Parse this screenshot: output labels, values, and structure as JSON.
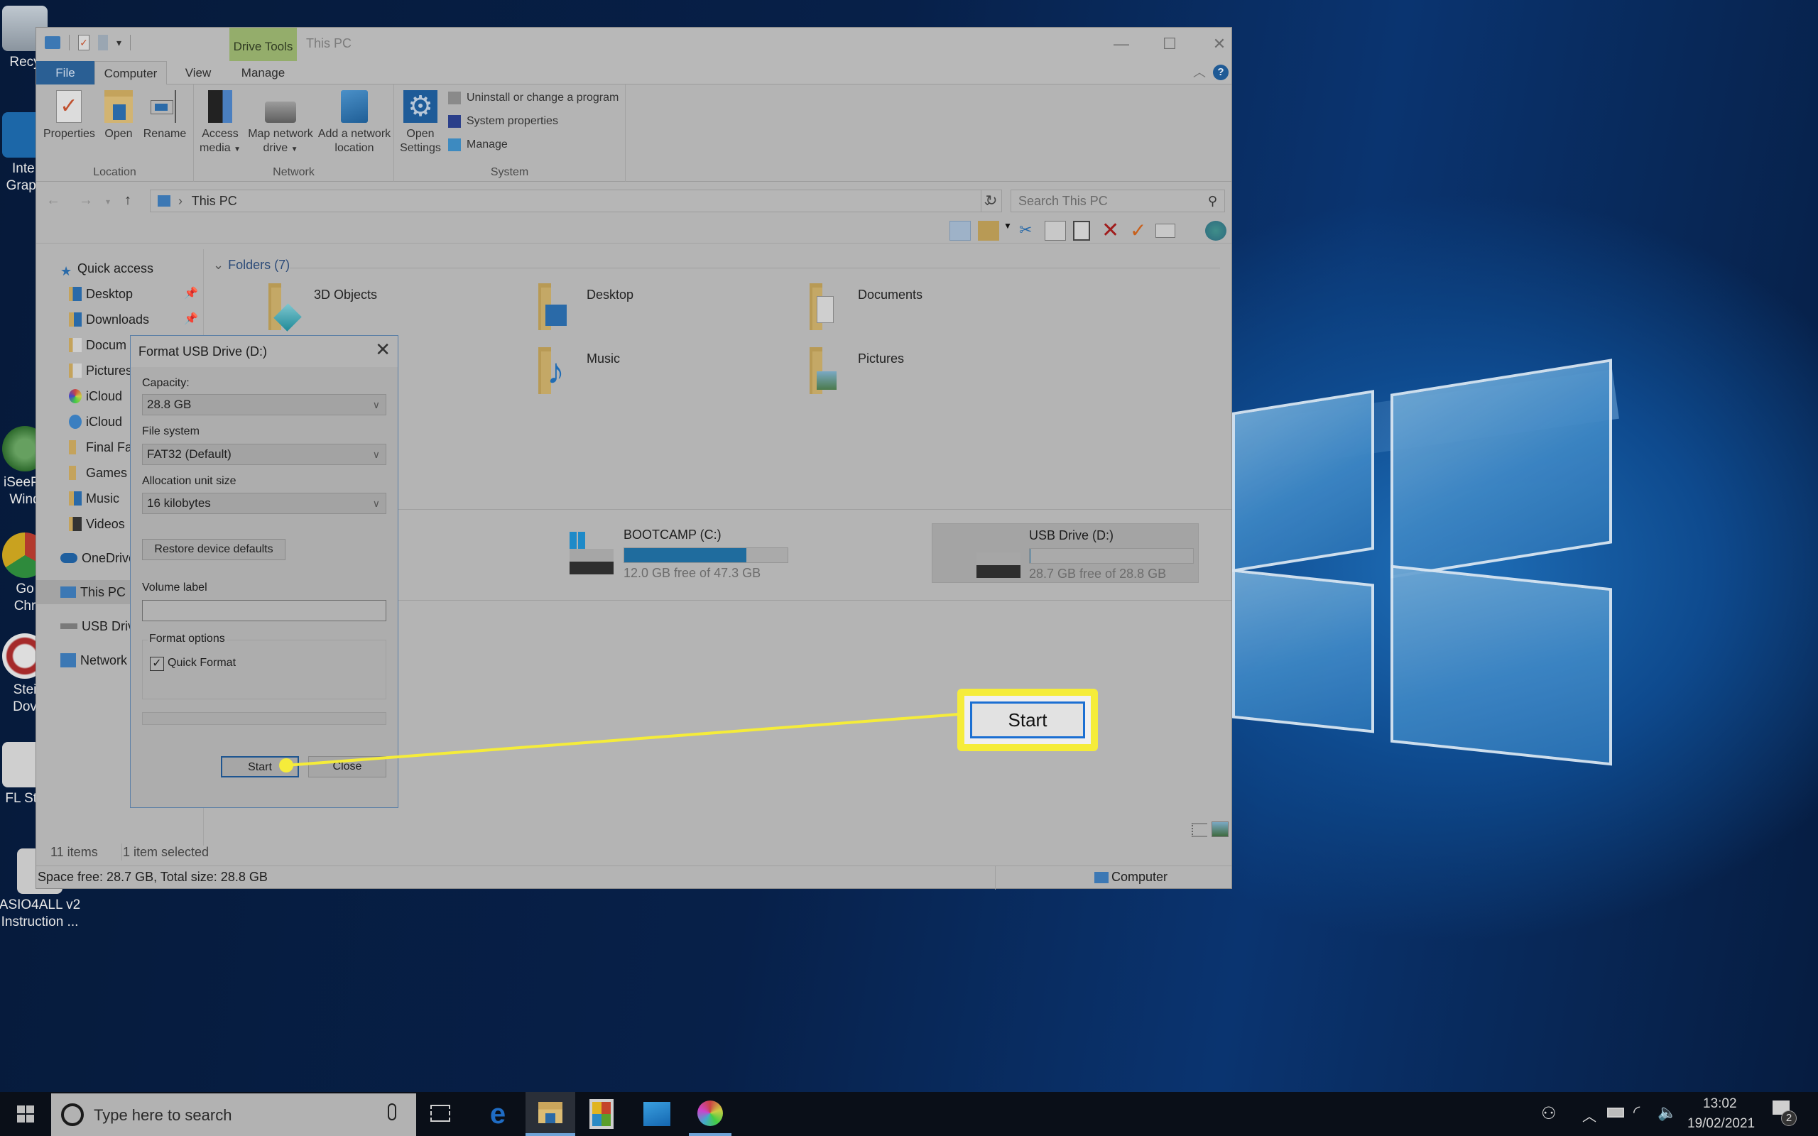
{
  "desktop": {
    "icons": [
      {
        "label": "Recy",
        "name": "recycle-bin"
      },
      {
        "label": "Intel Graph",
        "name": "intel-graphics"
      },
      {
        "label": "iSeePa Wind",
        "name": "iseepassword"
      },
      {
        "label": "Go Chr",
        "name": "google-chrome"
      },
      {
        "label": "Stei Dov",
        "name": "steinberg-download"
      },
      {
        "label": "FL Stu",
        "name": "fl-studio"
      },
      {
        "label": "ASIO4ALL v2 Instruction ...",
        "name": "asio4all"
      }
    ]
  },
  "explorer": {
    "title": "This PC",
    "context_tab": "Drive Tools",
    "tabs": [
      "File",
      "Computer",
      "View",
      "Manage"
    ],
    "active_tab": "Computer",
    "ribbon": {
      "groups": [
        {
          "label": "Location",
          "buttons": [
            "Properties",
            "Open",
            "Rename"
          ]
        },
        {
          "label": "Network",
          "buttons": [
            "Access media",
            "Map network drive",
            "Add a network location"
          ]
        },
        {
          "label": "System",
          "buttons": [
            "Open Settings"
          ],
          "small_buttons": [
            "Uninstall or change a program",
            "System properties",
            "Manage"
          ]
        }
      ],
      "btn_lines": {
        "properties": "Properties",
        "open": "Open",
        "rename": "Rename",
        "access1": "Access",
        "access2": "media",
        "map1": "Map network",
        "map2": "drive",
        "add1": "Add a network",
        "add2": "location",
        "settings1": "Open",
        "settings2": "Settings"
      }
    },
    "address": {
      "path": "This PC",
      "search_placeholder": "Search This PC"
    },
    "nav": {
      "items": [
        {
          "label": "Quick access",
          "level": 0
        },
        {
          "label": "Desktop",
          "level": 1,
          "pinned": true
        },
        {
          "label": "Downloads",
          "level": 1,
          "pinned": true
        },
        {
          "label": "Docum",
          "level": 1
        },
        {
          "label": "Pictures",
          "level": 1
        },
        {
          "label": "iCloud",
          "level": 1
        },
        {
          "label": "iCloud",
          "level": 1
        },
        {
          "label": "Final Fa",
          "level": 1
        },
        {
          "label": "Games",
          "level": 1
        },
        {
          "label": "Music",
          "level": 1
        },
        {
          "label": "Videos",
          "level": 1
        },
        {
          "label": "OneDrive",
          "level": 0
        },
        {
          "label": "This PC",
          "level": 0,
          "selected": true
        },
        {
          "label": "USB Driv",
          "level": 0
        },
        {
          "label": "Network",
          "level": 0
        }
      ]
    },
    "folders": {
      "header": "Folders (7)",
      "items": [
        "3D Objects",
        "Desktop",
        "Documents",
        "Music",
        "Pictures"
      ]
    },
    "drives": [
      {
        "name": "BOOTCAMP (C:)",
        "free": "12.0 GB free of 47.3 GB",
        "used_fraction": 0.746,
        "selected": false
      },
      {
        "name": "USB Drive (D:)",
        "free": "28.7 GB free of 28.8 GB",
        "used_fraction": 0.003,
        "selected": true
      }
    ],
    "status": {
      "items": "11 items",
      "selected": "1 item selected",
      "space": "Space free: 28.7 GB, Total size: 28.8 GB",
      "location": "Computer"
    }
  },
  "format_dialog": {
    "title": "Format USB Drive (D:)",
    "capacity_label": "Capacity:",
    "capacity_value": "28.8 GB",
    "fs_label": "File system",
    "fs_value": "FAT32 (Default)",
    "alloc_label": "Allocation unit size",
    "alloc_value": "16 kilobytes",
    "restore_label": "Restore device defaults",
    "volume_label": "Volume label",
    "volume_value": "",
    "options_label": "Format options",
    "quick_format_label": "Quick Format",
    "quick_format_checked": true,
    "progress": 0,
    "start_label": "Start",
    "close_label": "Close"
  },
  "callout": {
    "label": "Start",
    "color": "#f5ec3a"
  },
  "taskbar": {
    "search_placeholder": "Type here to search",
    "time": "13:02",
    "date": "19/02/2021",
    "notifications": "2"
  }
}
